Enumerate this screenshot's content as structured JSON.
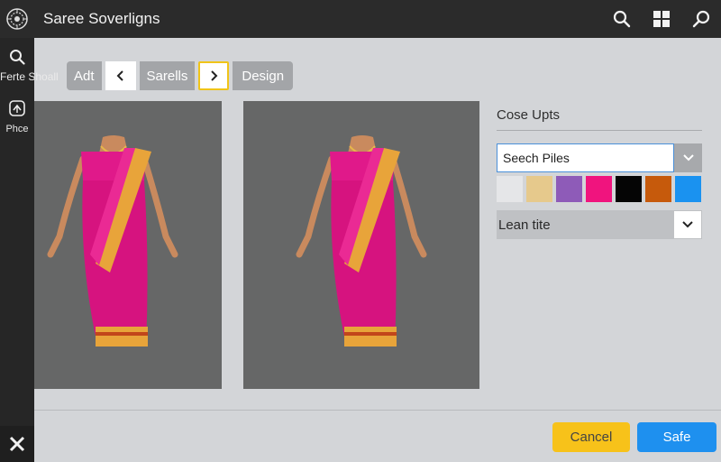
{
  "app": {
    "title": "Saree Soverligns",
    "logo_icon": "mandala-logo-icon"
  },
  "topbar": {
    "icons": [
      "search-icon",
      "grid-icon",
      "search-alt-icon"
    ]
  },
  "sidebar": {
    "items": [
      {
        "label": "Ferte Shoall",
        "icon": "search-icon"
      },
      {
        "label": "Phce",
        "icon": "tag-icon"
      }
    ],
    "close_icon": "close-icon"
  },
  "toolbar": {
    "adt_label": "Adt",
    "prev_icon": "chevron-left-icon",
    "sarells_label": "Sarells",
    "next_icon": "chevron-right-icon",
    "design_label": "Design"
  },
  "preview": {
    "images": [
      {
        "name": "saree-model-left",
        "saree_color": "#e0198a",
        "border_color": "#e8a43a"
      },
      {
        "name": "saree-model-right",
        "saree_color": "#e0198a",
        "border_color": "#e8a43a"
      }
    ]
  },
  "options": {
    "title": "Cose Upts",
    "search": {
      "value": "Seech Piles",
      "dropdown_icon": "check-chevron-icon"
    },
    "swatches": [
      "#e5e6e8",
      "#e6c98c",
      "#8e5bb8",
      "#f0147e",
      "#050505",
      "#c65a0c",
      "#1a92f0"
    ],
    "lean": {
      "label": "Lean tite",
      "dropdown_icon": "chevron-down-icon"
    }
  },
  "footer": {
    "cancel_label": "Cancel",
    "safe_label": "Safe"
  },
  "colors": {
    "topbar_bg": "#2b2b2b",
    "sidebar_bg": "#262626",
    "cancel_bg": "#f7c21a",
    "safe_bg": "#1e90ef"
  }
}
